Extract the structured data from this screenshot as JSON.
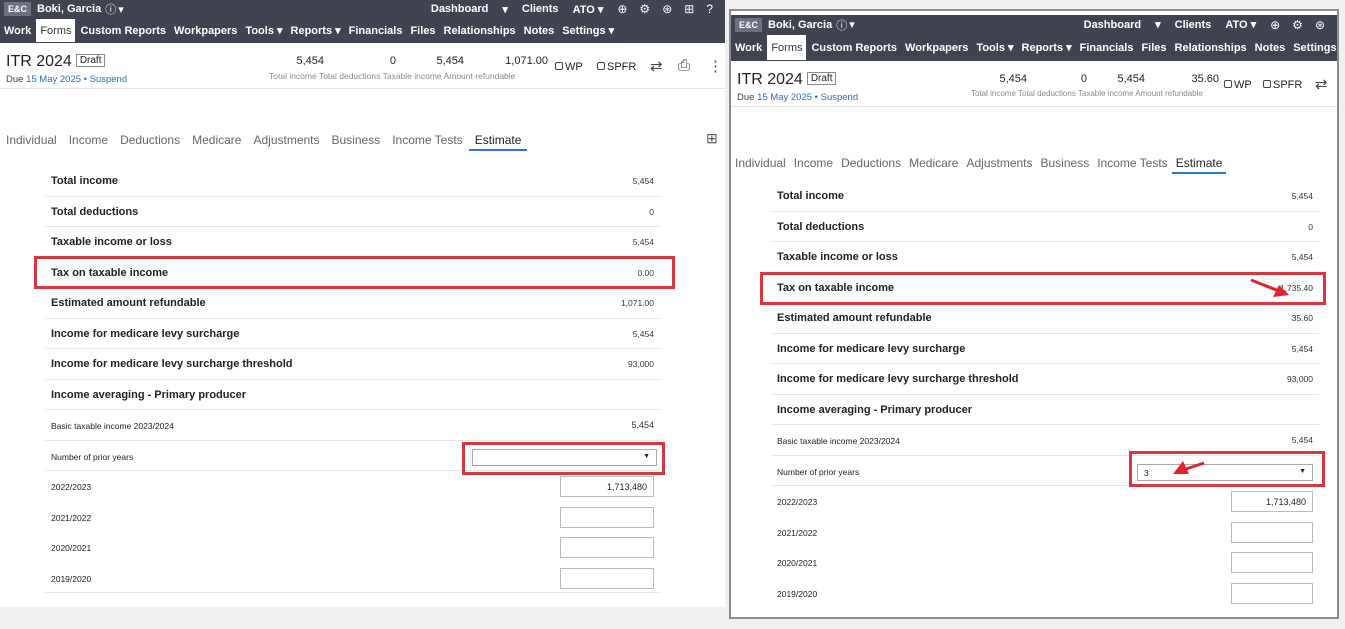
{
  "topbar": {
    "brand": "E&C",
    "client": "Boki, Garcia",
    "info_icon": "ⓘ",
    "caret": "▾",
    "links": [
      "Dashboard",
      "▾",
      "Clients",
      "ATO ▾"
    ],
    "icons": [
      "plus-circle-icon",
      "gear-icon",
      "user-icon",
      "gift-icon",
      "help-icon"
    ],
    "icon_glyphs": [
      "⊕",
      "⚙",
      "⊛",
      "⊞",
      "?"
    ]
  },
  "menu": [
    "Work",
    "Forms",
    "Custom Reports",
    "Workpapers",
    "Tools ▾",
    "Reports ▾",
    "Financials",
    "Files",
    "Relationships",
    "Notes",
    "Settings ▾"
  ],
  "header": {
    "title": "ITR 2024",
    "status": "Draft",
    "due_label": "Due",
    "due_date": "15 May 2025",
    "due_sep": "•",
    "suspend": "Suspend",
    "wp": "WP",
    "spfr": "SPFR",
    "summary_labels": [
      "Total income",
      "Total deductions",
      "Taxable income",
      "Amount refundable"
    ]
  },
  "tabs": [
    "Individual",
    "Income",
    "Deductions",
    "Medicare",
    "Adjustments",
    "Business",
    "Income Tests",
    "Estimate"
  ],
  "rows": {
    "total_income": "Total income",
    "total_deductions": "Total deductions",
    "taxable_income": "Taxable income or loss",
    "tax_on_taxable": "Tax on taxable income",
    "est_refundable": "Estimated amount refundable",
    "mls_income": "Income for medicare levy surcharge",
    "mls_threshold": "Income for medicare levy surcharge threshold",
    "averaging": "Income averaging - Primary producer",
    "basic_taxable": "Basic taxable income 2023/2024",
    "prior_years": "Number of prior years",
    "years": [
      "2022/2023",
      "2021/2022",
      "2020/2021",
      "2019/2020"
    ]
  },
  "left": {
    "summary_values": [
      "5,454",
      "0",
      "5,454",
      "1,071.00"
    ],
    "total_income": "5,454",
    "total_deductions": "0",
    "taxable_income": "5,454",
    "tax_on_taxable": "0.00",
    "est_refundable": "1,071.00",
    "mls_income": "5,454",
    "mls_threshold": "93,000",
    "basic_taxable": "5,454",
    "prior_years": "",
    "year_values": [
      "1,713,480",
      "",
      "",
      ""
    ]
  },
  "right": {
    "summary_values": [
      "5,454",
      "0",
      "5,454",
      "35.60"
    ],
    "total_income": "5,454",
    "total_deductions": "0",
    "taxable_income": "5,454",
    "tax_on_taxable": "1,735.40",
    "est_refundable": "35.60",
    "mls_income": "5,454",
    "mls_threshold": "93,000",
    "basic_taxable": "5,454",
    "prior_years": "3",
    "year_values": [
      "1,713,480",
      "",
      "",
      ""
    ]
  },
  "colors": {
    "nav": "#3f4450",
    "highlight": "#d9373f",
    "tab_active": "#2a78c8",
    "link": "#2a6ebb"
  }
}
